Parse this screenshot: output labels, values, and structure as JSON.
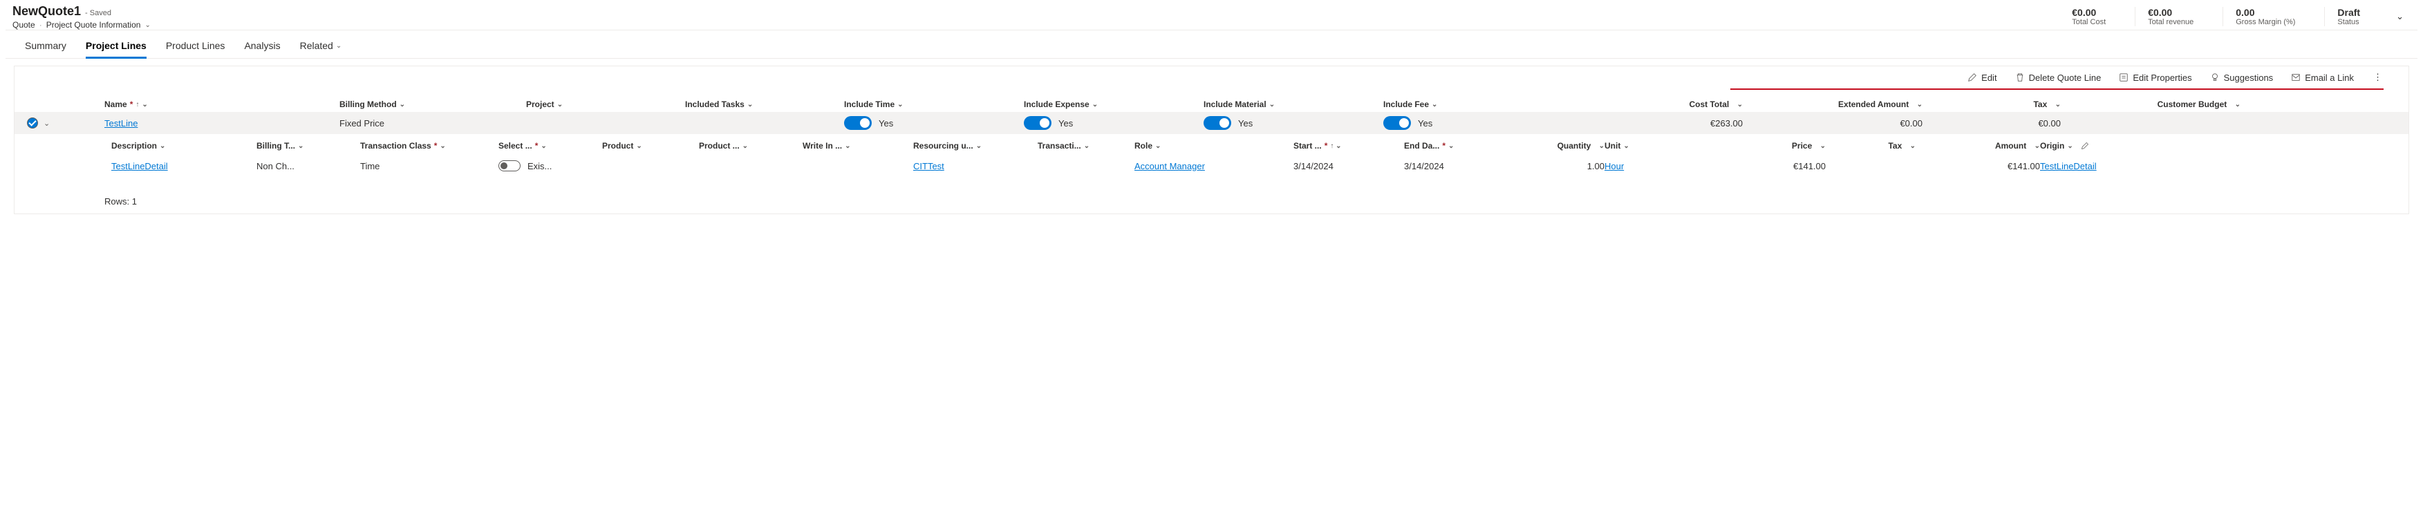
{
  "header": {
    "title": "NewQuote1",
    "saved": "- Saved",
    "crumb1": "Quote",
    "crumb2": "Project Quote Information",
    "metrics": [
      {
        "value": "€0.00",
        "label": "Total Cost"
      },
      {
        "value": "€0.00",
        "label": "Total revenue"
      },
      {
        "value": "0.00",
        "label": "Gross Margin (%)"
      },
      {
        "value": "Draft",
        "label": "Status"
      }
    ]
  },
  "tabs": {
    "summary": "Summary",
    "project_lines": "Project Lines",
    "product_lines": "Product Lines",
    "analysis": "Analysis",
    "related": "Related"
  },
  "toolbar": {
    "edit": "Edit",
    "delete": "Delete Quote Line",
    "props": "Edit Properties",
    "suggest": "Suggestions",
    "email": "Email a Link"
  },
  "outer_cols": {
    "name": "Name",
    "billing": "Billing Method",
    "project": "Project",
    "included": "Included Tasks",
    "time": "Include Time",
    "expense": "Include Expense",
    "material": "Include Material",
    "fee": "Include Fee",
    "cost": "Cost Total",
    "extended": "Extended Amount",
    "tax": "Tax",
    "budget": "Customer Budget"
  },
  "outer_row": {
    "name": "TestLine",
    "billing": "Fixed Price",
    "yes": "Yes",
    "cost": "€263.00",
    "extended": "€0.00",
    "tax": "€0.00"
  },
  "inner_cols": {
    "desc": "Description",
    "bill": "Billing T...",
    "trans": "Transaction Class",
    "select_full": "Select ...",
    "product": "Product",
    "product2": "Product ...",
    "write": "Write In ...",
    "resource": "Resourcing u...",
    "transacti": "Transacti...",
    "role": "Role",
    "start": "Start ...",
    "end": "End Da...",
    "qty": "Quantity",
    "unit": "Unit",
    "price": "Price",
    "tax": "Tax",
    "amount": "Amount",
    "origin": "Origin"
  },
  "inner_row": {
    "desc": "TestLineDetail",
    "bill": "Non Ch...",
    "trans": "Time",
    "select": "Exis...",
    "resource": "CITTest",
    "role": "Account Manager",
    "start": "3/14/2024",
    "end": "3/14/2024",
    "qty": "1.00",
    "unit": "Hour",
    "price": "€141.00",
    "amount": "€141.00",
    "origin": "TestLineDetail"
  },
  "rows_label": "Rows: 1"
}
